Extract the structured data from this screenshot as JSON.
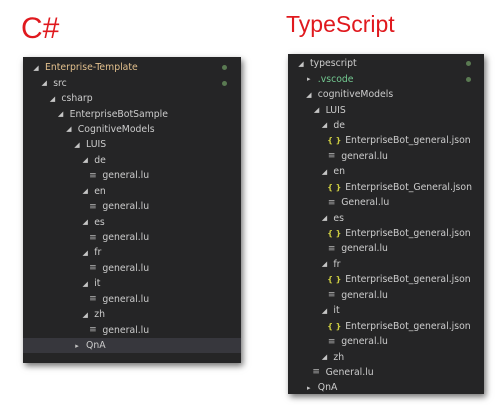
{
  "headings": {
    "left": "C#",
    "right": "TypeScript"
  },
  "colors": {
    "heading": "#e0191e",
    "panel_bg": "#252526",
    "text": "#cccccc",
    "root_folder": "#e2c08d",
    "modified_folder": "#73c991",
    "status_dot": "#5a7a52",
    "json_icon": "#cbcb41"
  },
  "left_tree": [
    {
      "label": "Enterprise-Template",
      "depth": 0,
      "arrow": "open",
      "icon": "",
      "root": true,
      "dot": true
    },
    {
      "label": "src",
      "depth": 1,
      "arrow": "open",
      "icon": "",
      "dot": true
    },
    {
      "label": "csharp",
      "depth": 2,
      "arrow": "open",
      "icon": ""
    },
    {
      "label": "EnterpriseBotSample",
      "depth": 3,
      "arrow": "open",
      "icon": ""
    },
    {
      "label": "CognitiveModels",
      "depth": 4,
      "arrow": "open",
      "icon": ""
    },
    {
      "label": "LUIS",
      "depth": 5,
      "arrow": "open",
      "icon": ""
    },
    {
      "label": "de",
      "depth": 6,
      "arrow": "open",
      "icon": ""
    },
    {
      "label": "general.lu",
      "depth": 7,
      "arrow": "",
      "icon": "lu-file-icon"
    },
    {
      "label": "en",
      "depth": 6,
      "arrow": "open",
      "icon": ""
    },
    {
      "label": "general.lu",
      "depth": 7,
      "arrow": "",
      "icon": "lu-file-icon"
    },
    {
      "label": "es",
      "depth": 6,
      "arrow": "open",
      "icon": ""
    },
    {
      "label": "general.lu",
      "depth": 7,
      "arrow": "",
      "icon": "lu-file-icon"
    },
    {
      "label": "fr",
      "depth": 6,
      "arrow": "open",
      "icon": ""
    },
    {
      "label": "general.lu",
      "depth": 7,
      "arrow": "",
      "icon": "lu-file-icon"
    },
    {
      "label": "it",
      "depth": 6,
      "arrow": "open",
      "icon": ""
    },
    {
      "label": "general.lu",
      "depth": 7,
      "arrow": "",
      "icon": "lu-file-icon"
    },
    {
      "label": "zh",
      "depth": 6,
      "arrow": "open",
      "icon": ""
    },
    {
      "label": "general.lu",
      "depth": 7,
      "arrow": "",
      "icon": "lu-file-icon"
    },
    {
      "label": "QnA",
      "depth": 5,
      "arrow": "closed",
      "icon": "",
      "highlight": true
    }
  ],
  "right_tree": [
    {
      "label": "typescript",
      "depth": 0,
      "arrow": "open",
      "icon": "",
      "dot": true
    },
    {
      "label": ".vscode",
      "depth": 1,
      "arrow": "closed",
      "icon": "",
      "green": true,
      "dot": true
    },
    {
      "label": "cognitiveModels",
      "depth": 1,
      "arrow": "open",
      "icon": ""
    },
    {
      "label": "LUIS",
      "depth": 2,
      "arrow": "open",
      "icon": ""
    },
    {
      "label": "de",
      "depth": 3,
      "arrow": "open",
      "icon": ""
    },
    {
      "label": "EnterpriseBot_general.json",
      "depth": 4,
      "arrow": "",
      "icon": "json-file-icon"
    },
    {
      "label": "general.lu",
      "depth": 4,
      "arrow": "",
      "icon": "lu-file-icon"
    },
    {
      "label": "en",
      "depth": 3,
      "arrow": "open",
      "icon": ""
    },
    {
      "label": "EnterpriseBot_General.json",
      "depth": 4,
      "arrow": "",
      "icon": "json-file-icon"
    },
    {
      "label": "General.lu",
      "depth": 4,
      "arrow": "",
      "icon": "lu-file-icon"
    },
    {
      "label": "es",
      "depth": 3,
      "arrow": "open",
      "icon": ""
    },
    {
      "label": "EnterpriseBot_general.json",
      "depth": 4,
      "arrow": "",
      "icon": "json-file-icon"
    },
    {
      "label": "general.lu",
      "depth": 4,
      "arrow": "",
      "icon": "lu-file-icon"
    },
    {
      "label": "fr",
      "depth": 3,
      "arrow": "open",
      "icon": ""
    },
    {
      "label": "EnterpriseBot_general.json",
      "depth": 4,
      "arrow": "",
      "icon": "json-file-icon"
    },
    {
      "label": "general.lu",
      "depth": 4,
      "arrow": "",
      "icon": "lu-file-icon"
    },
    {
      "label": "it",
      "depth": 3,
      "arrow": "open",
      "icon": ""
    },
    {
      "label": "EnterpriseBot_general.json",
      "depth": 4,
      "arrow": "",
      "icon": "json-file-icon"
    },
    {
      "label": "general.lu",
      "depth": 4,
      "arrow": "",
      "icon": "lu-file-icon"
    },
    {
      "label": "zh",
      "depth": 3,
      "arrow": "open",
      "icon": ""
    },
    {
      "label": "General.lu",
      "depth": 2,
      "arrow": "",
      "icon": "lu-file-icon"
    },
    {
      "label": "QnA",
      "depth": 1,
      "arrow": "closed",
      "icon": ""
    }
  ]
}
